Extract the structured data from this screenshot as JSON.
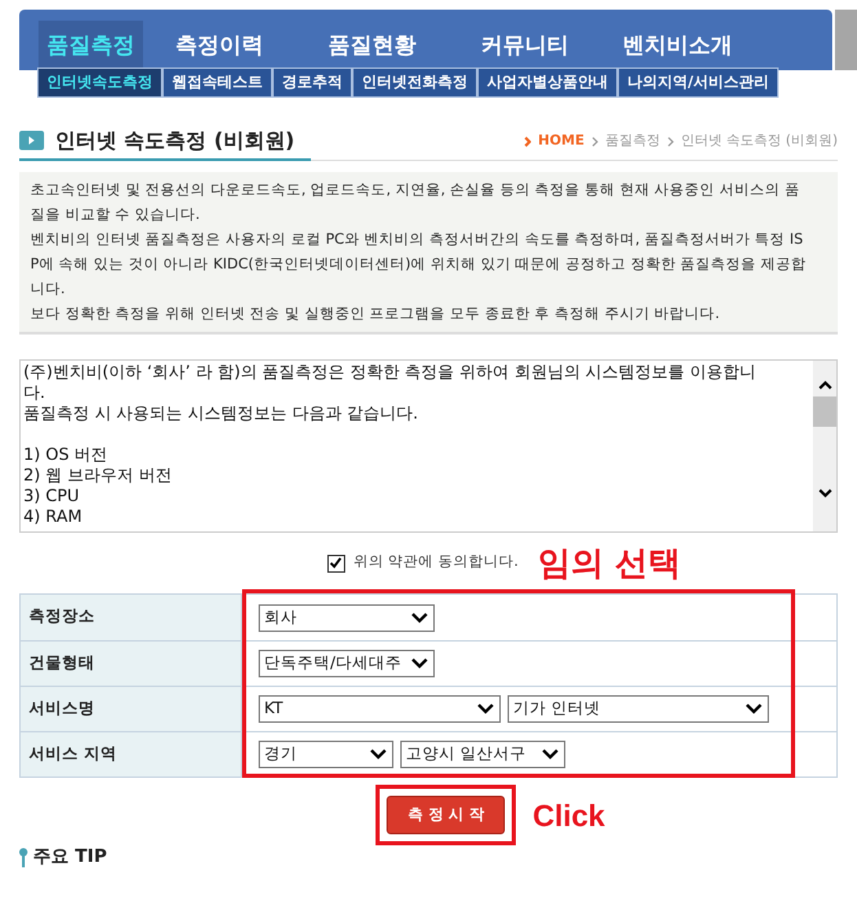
{
  "main_nav": [
    {
      "label": "품질측정",
      "selected": true
    },
    {
      "label": "측정이력",
      "selected": false
    },
    {
      "label": "품질현황",
      "selected": false
    },
    {
      "label": "커뮤니티",
      "selected": false
    },
    {
      "label": "벤치비소개",
      "selected": false
    }
  ],
  "sub_nav": [
    {
      "label": "인터넷속도측정",
      "selected": true
    },
    {
      "label": "웹접속테스트",
      "selected": false
    },
    {
      "label": "경로추적",
      "selected": false
    },
    {
      "label": "인터넷전화측정",
      "selected": false
    },
    {
      "label": "사업자별상품안내",
      "selected": false
    },
    {
      "label": "나의지역/서비스관리",
      "selected": false
    }
  ],
  "page_title": "인터넷 속도측정 (비회원)",
  "breadcrumb": [
    "HOME",
    "품질측정",
    "인터넷 속도측정 (비회원)"
  ],
  "description": [
    "초고속인터넷 및 전용선의 다운로드속도, 업로드속도, 지연율, 손실율 등의 측정을 통해 현재 사용중인 서비스의 품질을 비교할 수 있습니다.",
    "벤치비의 인터넷 품질측정은 사용자의 로컬 PC와 벤치비의 측정서버간의 속도를 측정하며, 품질측정서버가 특정 ISP에 속해 있는 것이 아니라 KIDC(한국인터넷데이터센터)에 위치해 있기 때문에 공정하고 정확한 품질측정을 제공합니다.",
    "보다 정확한 측정을 위해 인터넷 전송 및 실행중인 프로그램을 모두 종료한 후 측정해 주시기 바랍니다."
  ],
  "terms_intro": [
    "(주)벤치비(이하  ‘회사’ 라 함)의 품질측정은 정확한 측정을 위하여 회원님의 시스템정보를 이용합니다.",
    "품질측정 시 사용되는 시스템정보는 다음과 같습니다."
  ],
  "terms_list": [
    "1) OS 버전",
    "2) 웹 브라우저 버전",
    "3) CPU",
    "4) RAM"
  ],
  "agree": {
    "label": "위의 약관에 동의합니다.",
    "checked": true
  },
  "annotation_select": "임의 선택",
  "form_rows": [
    {
      "label": "측정장소",
      "selects": [
        "회사"
      ]
    },
    {
      "label": "건물형태",
      "selects": [
        "단독주택/다세대주"
      ]
    },
    {
      "label": "서비스명",
      "selects": [
        "KT",
        "기가 인터넷"
      ]
    },
    {
      "label": "서비스 지역",
      "selects": [
        "경기",
        "고양시 일산서구"
      ]
    }
  ],
  "start_button": "측 정 시 작",
  "annotation_click": "Click",
  "tip_heading": "주요 TIP"
}
